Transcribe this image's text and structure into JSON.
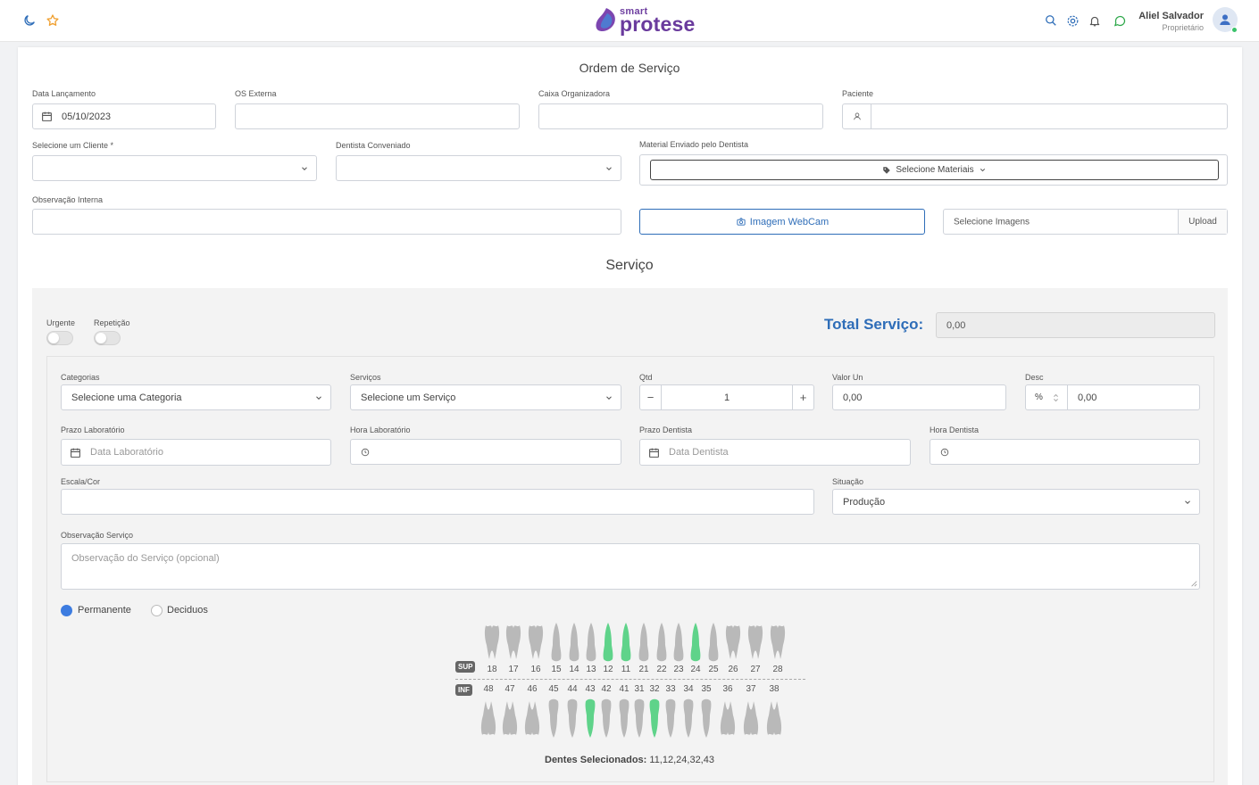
{
  "header": {
    "logo_small": "smart",
    "logo_big": "protese",
    "user_name": "Aliel Salvador",
    "user_role": "Proprietário",
    "icons": [
      "moon-icon",
      "star-icon",
      "search-icon",
      "gear-icon",
      "bell-icon",
      "chat-icon",
      "user-icon"
    ]
  },
  "os": {
    "title": "Ordem de Serviço",
    "data_lancamento_label": "Data Lançamento",
    "data_lancamento_value": "05/10/2023",
    "os_externa_label": "OS Externa",
    "caixa_label": "Caixa Organizadora",
    "paciente_label": "Paciente",
    "cliente_label": "Selecione um Cliente *",
    "dentista_label": "Dentista Conveniado",
    "material_label": "Material Enviado pelo Dentista",
    "material_button": "Selecione Materiais",
    "obs_interna_label": "Observação Interna",
    "webcam_button": "Imagem WebCam",
    "imagens_placeholder": "Selecione Imagens",
    "upload_button": "Upload"
  },
  "servico": {
    "title": "Serviço",
    "urgente_label": "Urgente",
    "repeticao_label": "Repetição",
    "total_label": "Total Serviço:",
    "total_value": "0,00",
    "categorias_label": "Categorias",
    "categorias_value": "Selecione uma Categoria",
    "servicos_label": "Serviços",
    "servicos_value": "Selecione um Serviço",
    "qtd_label": "Qtd",
    "qtd_minus": "−",
    "qtd_value": "1",
    "qtd_plus": "+",
    "valor_un_label": "Valor Un",
    "valor_un_value": "0,00",
    "desc_label": "Desc",
    "desc_unit": "%",
    "desc_value": "0,00",
    "prazo_lab_label": "Prazo Laboratório",
    "prazo_lab_placeholder": "Data Laboratório",
    "hora_lab_label": "Hora Laboratório",
    "prazo_dentista_label": "Prazo Dentista",
    "prazo_dentista_placeholder": "Data Dentista",
    "hora_dentista_label": "Hora Dentista",
    "escala_label": "Escala/Cor",
    "situacao_label": "Situação",
    "situacao_value": "Produção",
    "obs_servico_label": "Observação Serviço",
    "obs_servico_placeholder": "Observação do Serviço (opcional)",
    "radio_permanente": "Permanente",
    "radio_deciduos": "Deciduos",
    "dentition_selected": "Permanente"
  },
  "teeth": {
    "sup_tag": "SUP",
    "inf_tag": "INF",
    "upper": [
      "18",
      "17",
      "16",
      "15",
      "14",
      "13",
      "12",
      "11",
      "21",
      "22",
      "23",
      "24",
      "25",
      "26",
      "27",
      "28"
    ],
    "lower": [
      "48",
      "47",
      "46",
      "45",
      "44",
      "43",
      "42",
      "41",
      "31",
      "32",
      "33",
      "34",
      "35",
      "36",
      "37",
      "38"
    ],
    "selected": [
      "11",
      "12",
      "24",
      "32",
      "43"
    ],
    "selected_label": "Dentes Selecionados:",
    "selected_text": "11,12,24,32,43",
    "colors": {
      "normal": "#b9b9b9",
      "selected": "#5fd38a"
    }
  },
  "colors": {
    "accent": "#2e6db8",
    "brand": "#6a3b9d"
  }
}
